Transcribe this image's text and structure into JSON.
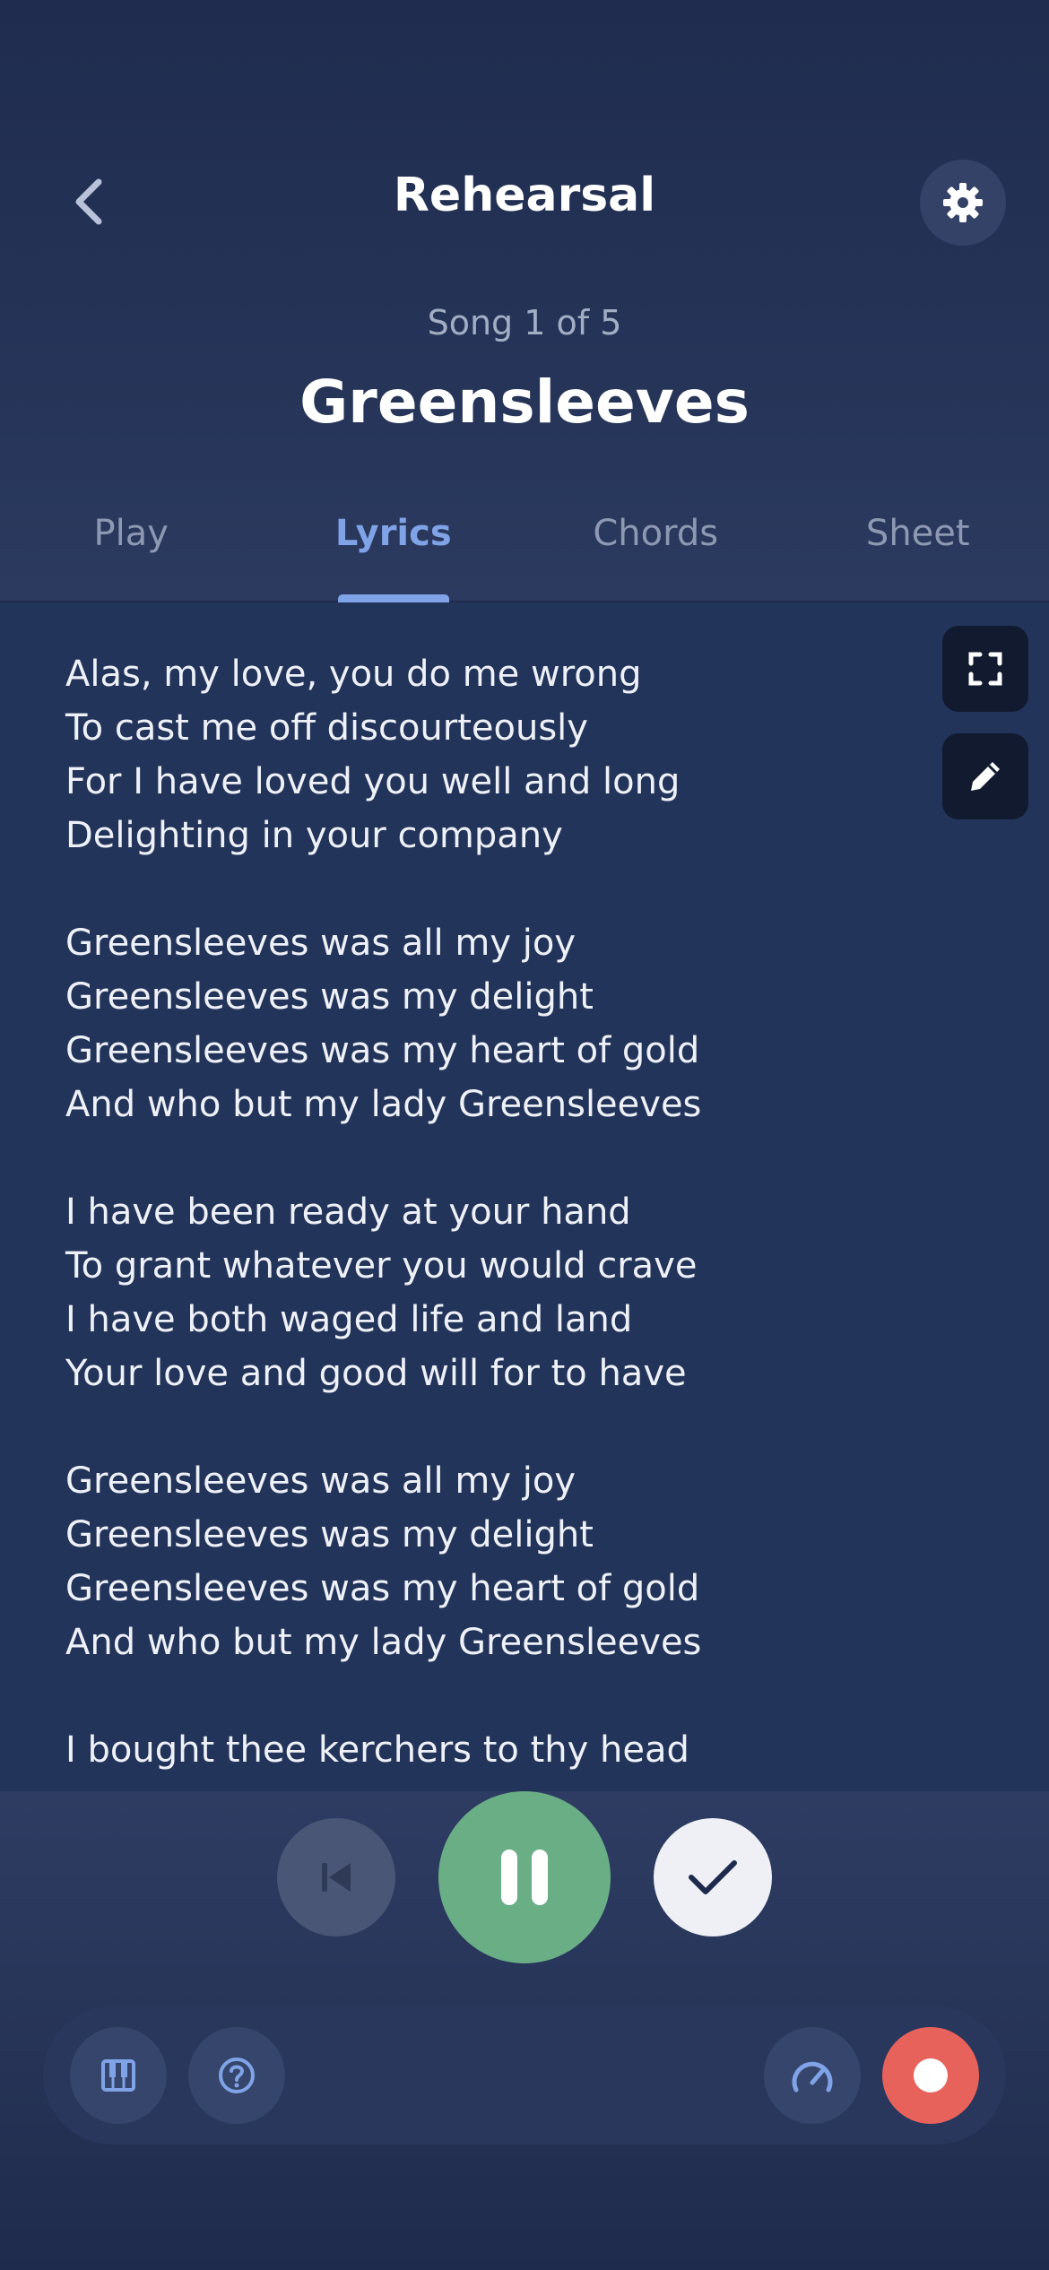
{
  "header": {
    "title": "Rehearsal",
    "back_icon": "chevron-left-icon",
    "settings_icon": "gear-icon"
  },
  "song": {
    "counter": "Song 1 of 5",
    "title": "Greensleeves"
  },
  "tabs": [
    {
      "label": "Play",
      "active": false
    },
    {
      "label": "Lyrics",
      "active": true
    },
    {
      "label": "Chords",
      "active": false
    },
    {
      "label": "Sheet",
      "active": false
    }
  ],
  "lyrics": {
    "stanzas": [
      [
        "Alas, my love, you do me wrong",
        "To cast me off discourteously",
        "For I have loved you well and long",
        "Delighting in your company"
      ],
      [
        "Greensleeves was all my joy",
        "Greensleeves was my delight",
        "Greensleeves was my heart of gold",
        "And who but my lady Greensleeves"
      ],
      [
        "I have been ready at your hand",
        "To grant whatever you would crave",
        "I have both waged life and land",
        "Your love and good will for to have"
      ],
      [
        "Greensleeves was all my joy",
        "Greensleeves was my delight",
        "Greensleeves was my heart of gold",
        "And who but my lady Greensleeves"
      ],
      [
        "I bought thee kerchers to thy head"
      ]
    ]
  },
  "side_tools": {
    "fullscreen_icon": "fullscreen-icon",
    "edit_icon": "pencil-icon"
  },
  "player": {
    "prev_icon": "skip-previous-icon",
    "pause_icon": "pause-icon",
    "done_icon": "checkmark-icon"
  },
  "toolbar": {
    "piano_icon": "piano-keys-icon",
    "help_icon": "help-circle-icon",
    "tempo_icon": "speedometer-icon",
    "record_icon": "record-icon"
  },
  "colors": {
    "accent": "#7fa3e6",
    "play": "#6aae86",
    "record": "#e8625c",
    "background": "#1e2a4c"
  }
}
